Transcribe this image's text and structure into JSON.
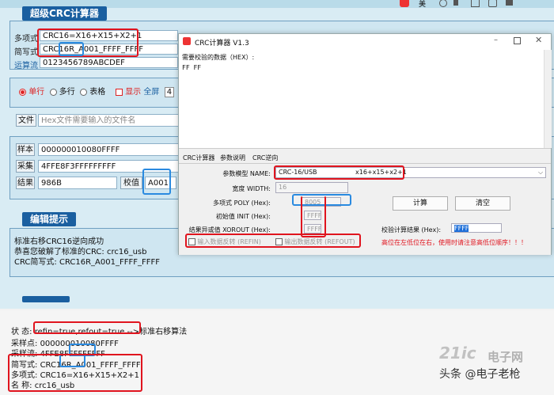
{
  "bg": {
    "section1_title": "超级CRC计算器",
    "section2_title": "编辑提示",
    "rows": [
      {
        "label": "多项式",
        "value": "CRC16=X16+X15+X2+1"
      },
      {
        "label": "简写式",
        "value_a": "CRC16R_",
        "value_b": "A001",
        "value_c": "_FFFF_FFFF"
      },
      {
        "label": "运算流",
        "value": "0123456789ABCDEF"
      }
    ],
    "modes": {
      "single": "单行",
      "multi": "多行",
      "table": "表格",
      "show": "显示",
      "all": "全屏",
      "extra": "4"
    },
    "file": {
      "label": "文件",
      "placeholder": "Hex文件需要输入的文件名"
    },
    "sample": {
      "label": "样本",
      "value": "000000010080FFFF"
    },
    "collect": {
      "label": "采集",
      "value": "4FFE8F3FFFFFFFFF"
    },
    "result": {
      "label": "结果",
      "value": "986B",
      "check_label": "校值",
      "check_value": "A001"
    },
    "hint_lines": [
      "标准右移CRC16逆向成功",
      "恭喜您破解了标准的CRC: crc16_usb",
      "CRC简写式: CRC16R_A001_FFFF_FFFF"
    ]
  },
  "topright": {
    "label": "美"
  },
  "window": {
    "title": "CRC计算器 V1.3",
    "input_label": "需要校验的数据（HEX）:",
    "input_value": "FF FF",
    "tabs": [
      "CRC计算器",
      "参数说明",
      "CRC逆向"
    ],
    "model_label": "参数模型 NAME:",
    "model_value": "CRC-16/USB",
    "model_poly": "x16+x15+x2+1",
    "width_label": "宽度 WIDTH:",
    "width_value": "16",
    "poly_label": "多项式 POLY (Hex):",
    "poly_value": "8005",
    "init_label": "初始值 INIT (Hex):",
    "init_value": "FFFF",
    "xorout_label": "结果异或值 XOROUT (Hex):",
    "xorout_value": "FFFF",
    "refin_label": "输入数据反转 (REFIN)",
    "refout_label": "输出数据反转 (REFOUT)",
    "calc_btn": "计算",
    "clear_btn": "清空",
    "result_label": "校验计算结果 (Hex):",
    "result_value": "FFFF",
    "warning": "高位在左低位在右，使用时请注意高低位顺序！！！"
  },
  "bottom": {
    "lines": [
      {
        "k": "状  态:",
        "v": "refin=true,refout=true",
        "tail": " -->标准右移算法"
      },
      {
        "k": "采样点:",
        "v": "000000010080FFFF"
      },
      {
        "k": "采样流:",
        "v": "4FFE8F",
        "v2": "FFFF",
        "v3": "FFFF"
      },
      {
        "k": "简写式:",
        "v": "CRC16R_",
        "v2": "A001",
        "v3": "_FFFF_FFFF"
      },
      {
        "k": "多项式:",
        "v": "CRC16=X16+X15+X2+1"
      },
      {
        "k": "名  称:",
        "v": "crc16_usb"
      }
    ]
  },
  "watermark": {
    "text": "头条 @电子老枪",
    "logo": "21ic",
    "logo2": "电子网"
  },
  "colors": {
    "red": "#e0141e",
    "blue": "#2a8ae0",
    "header": "#1a5fa0"
  }
}
